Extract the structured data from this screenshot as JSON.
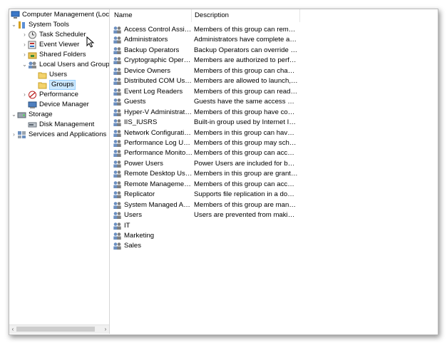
{
  "tree": {
    "root": "Computer Management (Local)",
    "system_tools": "System Tools",
    "task_scheduler": "Task Scheduler",
    "event_viewer": "Event Viewer",
    "shared_folders": "Shared Folders",
    "local_users_groups": "Local Users and Groups",
    "users": "Users",
    "groups": "Groups",
    "performance": "Performance",
    "device_manager": "Device Manager",
    "storage": "Storage",
    "disk_management": "Disk Management",
    "services_apps": "Services and Applications"
  },
  "list": {
    "columns": {
      "name": "Name",
      "description": "Description"
    },
    "rows": [
      {
        "name": "Access Control Assistance Operators",
        "desc": "Members of this group can remotely query authorization attributes"
      },
      {
        "name": "Administrators",
        "desc": "Administrators have complete and unrestricted access"
      },
      {
        "name": "Backup Operators",
        "desc": "Backup Operators can override security restrictions"
      },
      {
        "name": "Cryptographic Operators",
        "desc": "Members are authorized to perform cryptographic operations"
      },
      {
        "name": "Device Owners",
        "desc": "Members of this group can change system-wide settings"
      },
      {
        "name": "Distributed COM Users",
        "desc": "Members are allowed to launch, activate and use"
      },
      {
        "name": "Event Log Readers",
        "desc": "Members of this group can read event logs"
      },
      {
        "name": "Guests",
        "desc": "Guests have the same access as members of the Users group"
      },
      {
        "name": "Hyper-V Administrators",
        "desc": "Members of this group have complete and unrestricted access"
      },
      {
        "name": "IIS_IUSRS",
        "desc": "Built-in group used by Internet Information Services"
      },
      {
        "name": "Network Configuration Operators",
        "desc": "Members in this group can have some administrative privileges"
      },
      {
        "name": "Performance Log Users",
        "desc": "Members of this group may schedule logging of performance counters"
      },
      {
        "name": "Performance Monitor Users",
        "desc": "Members of this group can access performance counter data"
      },
      {
        "name": "Power Users",
        "desc": "Power Users are included for backwards compatibility"
      },
      {
        "name": "Remote Desktop Users",
        "desc": "Members in this group are granted the right to logon remotely"
      },
      {
        "name": "Remote Management Users",
        "desc": "Members of this group can access WMI resources"
      },
      {
        "name": "Replicator",
        "desc": "Supports file replication in a domain"
      },
      {
        "name": "System Managed Accounts Group",
        "desc": "Members of this group are managed by the system"
      },
      {
        "name": "Users",
        "desc": "Users are prevented from making accidental or intentional changes"
      },
      {
        "name": "IT",
        "desc": ""
      },
      {
        "name": "Marketing",
        "desc": ""
      },
      {
        "name": "Sales",
        "desc": ""
      }
    ]
  },
  "colors": {
    "selection": "#cce8ff",
    "selection_border": "#99d1ff"
  },
  "icons": {
    "root": "computer-management-icon",
    "tools": "tools-icon",
    "clock": "clock-icon",
    "event": "event-viewer-icon",
    "share": "shared-folder-icon",
    "users_groups": "users-groups-icon",
    "folder": "folder-icon",
    "performance": "performance-icon",
    "device": "device-manager-icon",
    "storage": "storage-icon",
    "disk": "disk-icon",
    "services": "services-icon",
    "group": "group-icon"
  }
}
